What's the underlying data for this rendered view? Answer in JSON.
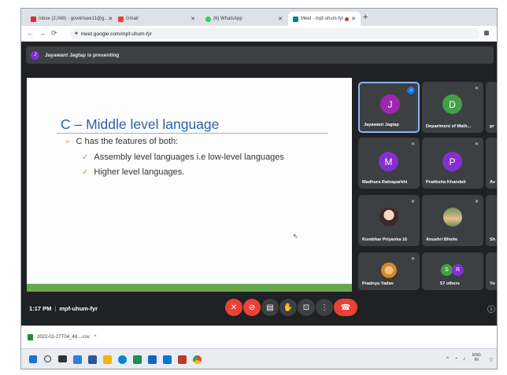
{
  "browser": {
    "tabs": [
      {
        "label": "Inbox (2,048) - gowimsee11@g...",
        "fav_color": "#d93025"
      },
      {
        "label": "Gmail",
        "fav_color": "#ea4335"
      },
      {
        "label": "(6) WhatsApp",
        "fav_color": "#25d366"
      },
      {
        "label": "Meet - mpf-uhum-fyr",
        "fav_color": "#00897b"
      }
    ],
    "new_tab": "+",
    "url": "meet.google.com/mpf-uhum-fyr"
  },
  "meet": {
    "presenting_initial": "J",
    "presenting_text": "Jayawant Jagtap is presenting",
    "slide": {
      "title": "C – Middle level language",
      "bullet1": "C has the features of both:",
      "sub_bullets": [
        "Assembly level languages i.e low-level languages",
        "Higher level languages."
      ]
    },
    "participants": [
      {
        "name": "Jayawant Jagtap",
        "initial": "J",
        "color": "#9c27b0"
      },
      {
        "name": "Department of Math...",
        "initial": "D",
        "color": "#43a047"
      },
      {
        "name": "pr",
        "initial": "",
        "color": "#3c4043"
      },
      {
        "name": "Madhura Ratnaparkhi",
        "initial": "M",
        "color": "#8430ce"
      },
      {
        "name": "Pratiksha Khandait",
        "initial": "P",
        "color": "#8430ce"
      },
      {
        "name": "Av",
        "initial": "",
        "color": "#3c4043"
      },
      {
        "name": "Kumbhar Priyanka 16",
        "initial": "",
        "color": ""
      },
      {
        "name": "Anushri Bhoite",
        "initial": "",
        "color": ""
      },
      {
        "name": "Sh",
        "initial": "",
        "color": ""
      },
      {
        "name": "Pradnya Yadav",
        "initial": "",
        "color": ""
      },
      {
        "name": "57 others",
        "initial": "",
        "color": ""
      },
      {
        "name": "Yo",
        "initial": "",
        "color": ""
      }
    ],
    "others_initials": [
      "S",
      "R"
    ],
    "time": "1:17 PM",
    "separator": "|",
    "meeting_code": "mpf-uhum-fyr"
  },
  "downloads": {
    "file": "2022-01-27T04_48....csv",
    "chevron": "^"
  },
  "taskbar": {
    "lang_top": "ENG",
    "lang_bottom": "IN"
  },
  "colors": {
    "accent": "#1a73e8",
    "end_call": "#ea4335",
    "slide_title": "#2e5fa8",
    "slide_footer": "#6aa84f"
  }
}
